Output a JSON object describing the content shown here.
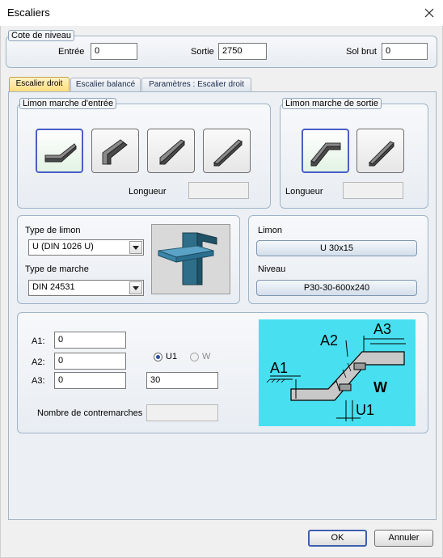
{
  "window": {
    "title": "Escaliers",
    "close_icon": "close-icon"
  },
  "level_group": {
    "legend": "Cote de niveau",
    "entree_label": "Entrée",
    "entree_value": "0",
    "sortie_label": "Sortie",
    "sortie_value": "2750",
    "sol_brut_label": "Sol brut",
    "sol_brut_value": "0"
  },
  "tabs": [
    {
      "label": "Escalier droit",
      "active": true
    },
    {
      "label": "Escalier balancé",
      "active": false
    },
    {
      "label": "Paramètres : Escalier droit",
      "active": false
    }
  ],
  "entry_group": {
    "legend": "Limon marche d'entrée",
    "longueur_label": "Longueur",
    "longueur_value": "",
    "buttons": [
      {
        "icon": "stringer-bent-entry-icon",
        "selected": true
      },
      {
        "icon": "stringer-notched-entry-icon",
        "selected": false
      },
      {
        "icon": "stringer-angled-entry-icon",
        "selected": false
      },
      {
        "icon": "stringer-straight-entry-icon",
        "selected": false
      }
    ]
  },
  "exit_group": {
    "legend": "Limon marche de sortie",
    "longueur_label": "Longueur",
    "longueur_value": "",
    "buttons": [
      {
        "icon": "stringer-bent-exit-icon",
        "selected": true
      },
      {
        "icon": "stringer-straight-exit-icon",
        "selected": false
      }
    ]
  },
  "type_group": {
    "limon_label": "Type de limon",
    "limon_value": "U (DIN 1026 U)",
    "marche_label": "Type de marche",
    "marche_value": "DIN 24531",
    "preview_icon": "stringer-profile-preview-icon"
  },
  "profile_group": {
    "limon_label": "Limon",
    "limon_button": "U 30x15",
    "niveau_label": "Niveau",
    "niveau_button": "P30-30-600x240"
  },
  "dims_group": {
    "a1_label": "A1:",
    "a1_value": "0",
    "a2_label": "A2:",
    "a2_value": "0",
    "a3_label": "A3:",
    "a3_value": "0",
    "u1_label": "U1",
    "w_label": "W",
    "u1_checked": true,
    "u_value": "30",
    "contremarches_label": "Nombre de contremarches",
    "contremarches_value": "",
    "diagram": {
      "a1": "A1",
      "a2": "A2",
      "a3": "A3",
      "w": "W",
      "u1": "U1",
      "background": "#48e0f0"
    }
  },
  "footer": {
    "ok_label": "OK",
    "cancel_label": "Annuler"
  },
  "colors": {
    "accent": "#3c5fae",
    "active_tab": "#ffdc7a"
  }
}
